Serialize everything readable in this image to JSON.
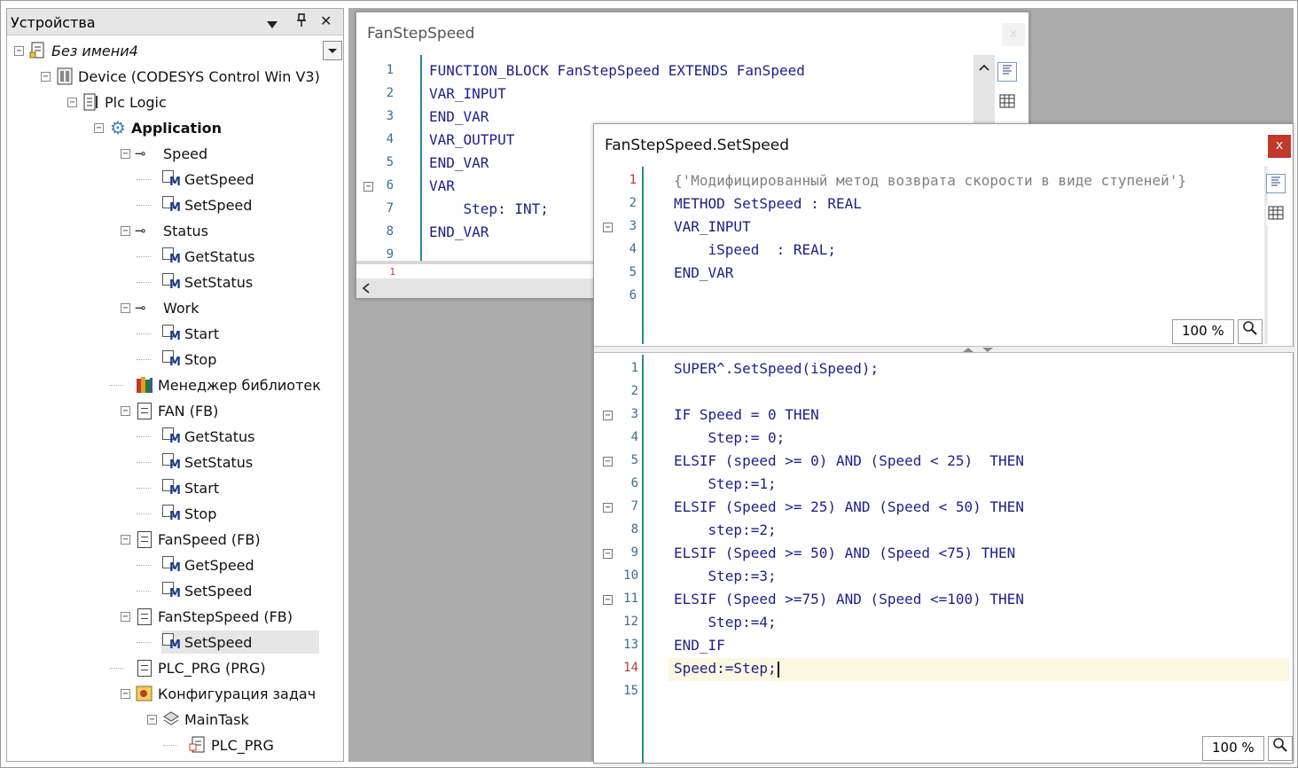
{
  "devices_panel": {
    "title": "Устройства",
    "dropdown_icon": "chevron-down-icon",
    "pin_label": "ᵖ",
    "close_label": "✕",
    "tree": [
      {
        "label": "Без имени4",
        "italic": true
      },
      {
        "label": "Device (CODESYS Control Win V3)"
      },
      {
        "label": "Plc Logic"
      },
      {
        "label": "Application",
        "bold": true
      },
      {
        "label": "Speed"
      },
      {
        "label": "GetSpeed"
      },
      {
        "label": "SetSpeed"
      },
      {
        "label": "Status"
      },
      {
        "label": "GetStatus"
      },
      {
        "label": "SetStatus"
      },
      {
        "label": "Work"
      },
      {
        "label": "Start"
      },
      {
        "label": "Stop"
      },
      {
        "label": "Менеджер библиотек"
      },
      {
        "label": "FAN (FB)"
      },
      {
        "label": "GetStatus"
      },
      {
        "label": "SetStatus"
      },
      {
        "label": "Start"
      },
      {
        "label": "Stop"
      },
      {
        "label": "FanSpeed (FB)"
      },
      {
        "label": "GetSpeed"
      },
      {
        "label": "SetSpeed"
      },
      {
        "label": "FanStepSpeed (FB)"
      },
      {
        "label": "SetSpeed",
        "selected": true
      },
      {
        "label": "PLC_PRG (PRG)"
      },
      {
        "label": "Конфигурация задач"
      },
      {
        "label": "MainTask"
      },
      {
        "label": "PLC_PRG"
      }
    ]
  },
  "editor1": {
    "title": "FanStepSpeed",
    "close_label": "x",
    "lines": [
      {
        "n": "1",
        "text": "FUNCTION_BLOCK FanStepSpeed EXTENDS FanSpeed"
      },
      {
        "n": "2",
        "text": "VAR_INPUT"
      },
      {
        "n": "3",
        "text": "END_VAR"
      },
      {
        "n": "4",
        "text": "VAR_OUTPUT"
      },
      {
        "n": "5",
        "text": "END_VAR"
      },
      {
        "n": "6",
        "text": "VAR"
      },
      {
        "n": "7",
        "text": "    Step: INT;"
      },
      {
        "n": "8",
        "text": "END_VAR"
      },
      {
        "n": "9",
        "text": ""
      }
    ],
    "bottom_line_number": "1"
  },
  "editor2": {
    "title": "FanStepSpeed.SetSpeed",
    "close_label": "x",
    "decl_lines": [
      {
        "n": "1",
        "text": "{'Модифицированный метод возврата скорости в виде ступеней'}",
        "comment": true
      },
      {
        "n": "2",
        "text": "METHOD SetSpeed : REAL"
      },
      {
        "n": "3",
        "text": "VAR_INPUT"
      },
      {
        "n": "4",
        "text": "    iSpeed  : REAL;"
      },
      {
        "n": "5",
        "text": "END_VAR"
      },
      {
        "n": "6",
        "text": ""
      }
    ],
    "decl_zoom": "100 %",
    "impl_lines": [
      {
        "n": "1",
        "text": "SUPER^.SetSpeed(iSpeed);"
      },
      {
        "n": "2",
        "text": ""
      },
      {
        "n": "3",
        "text": "IF Speed = 0 THEN"
      },
      {
        "n": "4",
        "text": "    Step:= 0;"
      },
      {
        "n": "5",
        "text": "ELSIF (speed >= 0) AND (Speed < 25)  THEN"
      },
      {
        "n": "6",
        "text": "    Step:=1;"
      },
      {
        "n": "7",
        "text": "ELSIF (Speed >= 25) AND (Speed < 50) THEN"
      },
      {
        "n": "8",
        "text": "    step:=2;"
      },
      {
        "n": "9",
        "text": "ELSIF (Speed >= 50) AND (Speed <75) THEN"
      },
      {
        "n": "10",
        "text": "    Step:=3;"
      },
      {
        "n": "11",
        "text": "ELSIF (Speed >=75) AND (Speed <=100) THEN"
      },
      {
        "n": "12",
        "text": "    Step:=4;"
      },
      {
        "n": "13",
        "text": "END_IF"
      },
      {
        "n": "14",
        "text": "Speed:=Step;"
      },
      {
        "n": "15",
        "text": ""
      }
    ],
    "impl_zoom": "100 %"
  }
}
